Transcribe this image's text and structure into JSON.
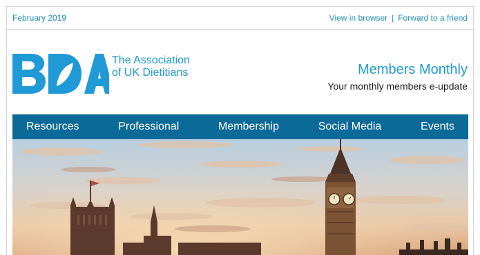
{
  "preheader": {
    "date": "February 2019",
    "view_in_browser": "View in browser",
    "separator": "|",
    "forward": "Forward to a friend"
  },
  "brand": {
    "logo_text": "BDA",
    "tagline": "The Association of UK Dietitians",
    "logo_color": "#1f9ad6"
  },
  "masthead": {
    "title": "Members Monthly",
    "subtitle": "Your monthly members e-update"
  },
  "nav": {
    "items": [
      {
        "label": "Resources"
      },
      {
        "label": "Professional"
      },
      {
        "label": "Membership"
      },
      {
        "label": "Social Media"
      },
      {
        "label": "Events"
      }
    ],
    "background": "#0c6a98"
  },
  "hero": {
    "icon": "westminster-skyline-photo"
  }
}
